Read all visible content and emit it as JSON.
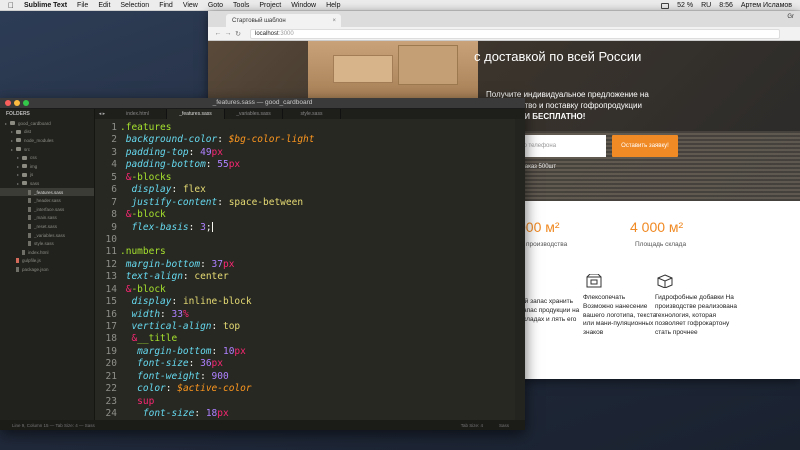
{
  "menubar": {
    "app": "Sublime Text",
    "items": [
      "File",
      "Edit",
      "Selection",
      "Find",
      "View",
      "Goto",
      "Tools",
      "Project",
      "Window",
      "Help"
    ],
    "battery": "52 %",
    "lang": "RU",
    "time": "8:56",
    "user": "Артем Исламов"
  },
  "browser": {
    "tab_title": "Стартовый шаблон",
    "profile": "Gr",
    "url_host": "localhost",
    "url_port": ":3000",
    "hero": {
      "title": "с доставкой по всей России",
      "sub_line1": "Получите индивидуальное предложение на",
      "sub_line2": "производство и поставку гофропродукции",
      "sub_line3": "УПАКОВКИ БЕСПЛАТНО!",
      "phone_placeholder": "мер телефона",
      "cta": "Оставить заявку!",
      "note": "заказ 500шт"
    },
    "stats": [
      {
        "value": "000 м²",
        "label": "производства"
      },
      {
        "value": "4 000 м²",
        "label": "Площадь склада"
      }
    ],
    "features": [
      {
        "icon": "partial-icon",
        "text": "ый запас хранить запас продукции на складах и лять его"
      },
      {
        "icon": "box-print-icon",
        "text": "Флексопечать Возможно нанесение вашего логотипа, текста или мани-пуляционных знаков"
      },
      {
        "icon": "box-water-icon",
        "text": "Гидрофобные добавки На производстве реализована технология, которая позволяет гофрокартону стать прочнее"
      }
    ]
  },
  "sublime": {
    "window_title": "_features.sass — good_cardboard",
    "sidebar_header": "FOLDERS",
    "tree": [
      {
        "label": "good_cardboard",
        "kind": "folder",
        "depth": 0
      },
      {
        "label": "dist",
        "kind": "folder",
        "depth": 1
      },
      {
        "label": "node_modules",
        "kind": "folder",
        "depth": 1
      },
      {
        "label": "src",
        "kind": "folder",
        "depth": 1
      },
      {
        "label": "css",
        "kind": "folder",
        "depth": 2
      },
      {
        "label": "img",
        "kind": "folder",
        "depth": 2
      },
      {
        "label": "js",
        "kind": "folder",
        "depth": 2
      },
      {
        "label": "sass",
        "kind": "folder",
        "depth": 2
      },
      {
        "label": "_features.sass",
        "kind": "file",
        "depth": 3,
        "selected": true
      },
      {
        "label": "_header.sass",
        "kind": "file",
        "depth": 3
      },
      {
        "label": "_interface.sass",
        "kind": "file",
        "depth": 3
      },
      {
        "label": "_main.sass",
        "kind": "file",
        "depth": 3
      },
      {
        "label": "_reset.sass",
        "kind": "file",
        "depth": 3
      },
      {
        "label": "_variables.sass",
        "kind": "file",
        "depth": 3
      },
      {
        "label": "style.sass",
        "kind": "file",
        "depth": 3
      },
      {
        "label": "index.html",
        "kind": "file",
        "depth": 2
      },
      {
        "label": "gulpfile.js",
        "kind": "js",
        "depth": 1
      },
      {
        "label": "package.json",
        "kind": "file",
        "depth": 1
      }
    ],
    "tabs": [
      "index.html",
      "_features.sass",
      "_variables.sass",
      "style.sass"
    ],
    "active_tab": 1,
    "line_numbers": [
      "1",
      "2",
      "3",
      "4",
      "5",
      "6",
      "7",
      "8",
      "9",
      "10",
      "11",
      "12",
      "13",
      "14",
      "15",
      "16",
      "17",
      "18",
      "19",
      "20",
      "21",
      "22",
      "23",
      "24"
    ],
    "code_lines": [
      [
        [
          ".features",
          "sel"
        ]
      ],
      [
        [
          " background-color",
          "prop"
        ],
        [
          ": ",
          "pl"
        ],
        [
          "$bg-color-light",
          "var"
        ]
      ],
      [
        [
          " padding-top",
          "prop"
        ],
        [
          ": ",
          "pl"
        ],
        [
          "49",
          "num"
        ],
        [
          "px",
          "unit"
        ]
      ],
      [
        [
          " padding-bottom",
          "prop"
        ],
        [
          ": ",
          "pl"
        ],
        [
          "55",
          "num"
        ],
        [
          "px",
          "unit"
        ]
      ],
      [
        [
          " &",
          "amp"
        ],
        [
          "-blocks",
          "sel"
        ]
      ],
      [
        [
          "  display",
          "prop"
        ],
        [
          ": ",
          "pl"
        ],
        [
          "flex",
          "val"
        ]
      ],
      [
        [
          "  justify-content",
          "prop"
        ],
        [
          ": ",
          "pl"
        ],
        [
          "space-between",
          "val"
        ]
      ],
      [
        [
          " &",
          "amp"
        ],
        [
          "-block",
          "sel"
        ]
      ],
      [
        [
          "  flex-basis",
          "prop"
        ],
        [
          ": ",
          "pl"
        ],
        [
          "3",
          "num"
        ],
        [
          ";",
          "pl"
        ],
        [
          "|",
          "cursor"
        ]
      ],
      [
        [
          "",
          "pl"
        ]
      ],
      [
        [
          ".numbers",
          "sel"
        ]
      ],
      [
        [
          " margin-bottom",
          "prop"
        ],
        [
          ": ",
          "pl"
        ],
        [
          "37",
          "num"
        ],
        [
          "px",
          "unit"
        ]
      ],
      [
        [
          " text-align",
          "prop"
        ],
        [
          ": ",
          "pl"
        ],
        [
          "center",
          "val"
        ]
      ],
      [
        [
          " &",
          "amp"
        ],
        [
          "-block",
          "sel"
        ]
      ],
      [
        [
          "  display",
          "prop"
        ],
        [
          ": ",
          "pl"
        ],
        [
          "inline-block",
          "val"
        ]
      ],
      [
        [
          "  width",
          "prop"
        ],
        [
          ": ",
          "pl"
        ],
        [
          "33",
          "num"
        ],
        [
          "%",
          "unit"
        ]
      ],
      [
        [
          "  vertical-align",
          "prop"
        ],
        [
          ": ",
          "pl"
        ],
        [
          "top",
          "val"
        ]
      ],
      [
        [
          "  &",
          "amp"
        ],
        [
          "__title",
          "sel"
        ]
      ],
      [
        [
          "   margin-bottom",
          "prop"
        ],
        [
          ": ",
          "pl"
        ],
        [
          "10",
          "num"
        ],
        [
          "px",
          "unit"
        ]
      ],
      [
        [
          "   font-size",
          "prop"
        ],
        [
          ": ",
          "pl"
        ],
        [
          "36",
          "num"
        ],
        [
          "px",
          "unit"
        ]
      ],
      [
        [
          "   font-weight",
          "prop"
        ],
        [
          ": ",
          "pl"
        ],
        [
          "900",
          "num"
        ]
      ],
      [
        [
          "   color",
          "prop"
        ],
        [
          ": ",
          "pl"
        ],
        [
          "$active-color",
          "var"
        ]
      ],
      [
        [
          "   sup",
          "tag"
        ]
      ],
      [
        [
          "    font-size",
          "prop"
        ],
        [
          ": ",
          "pl"
        ],
        [
          "18",
          "num"
        ],
        [
          "px",
          "unit"
        ]
      ]
    ],
    "status_left": "Line 9, Column 15 — Tab Size: 4 — Sass",
    "status_tab": "Tab Size: 4",
    "status_syntax": "Sass"
  }
}
